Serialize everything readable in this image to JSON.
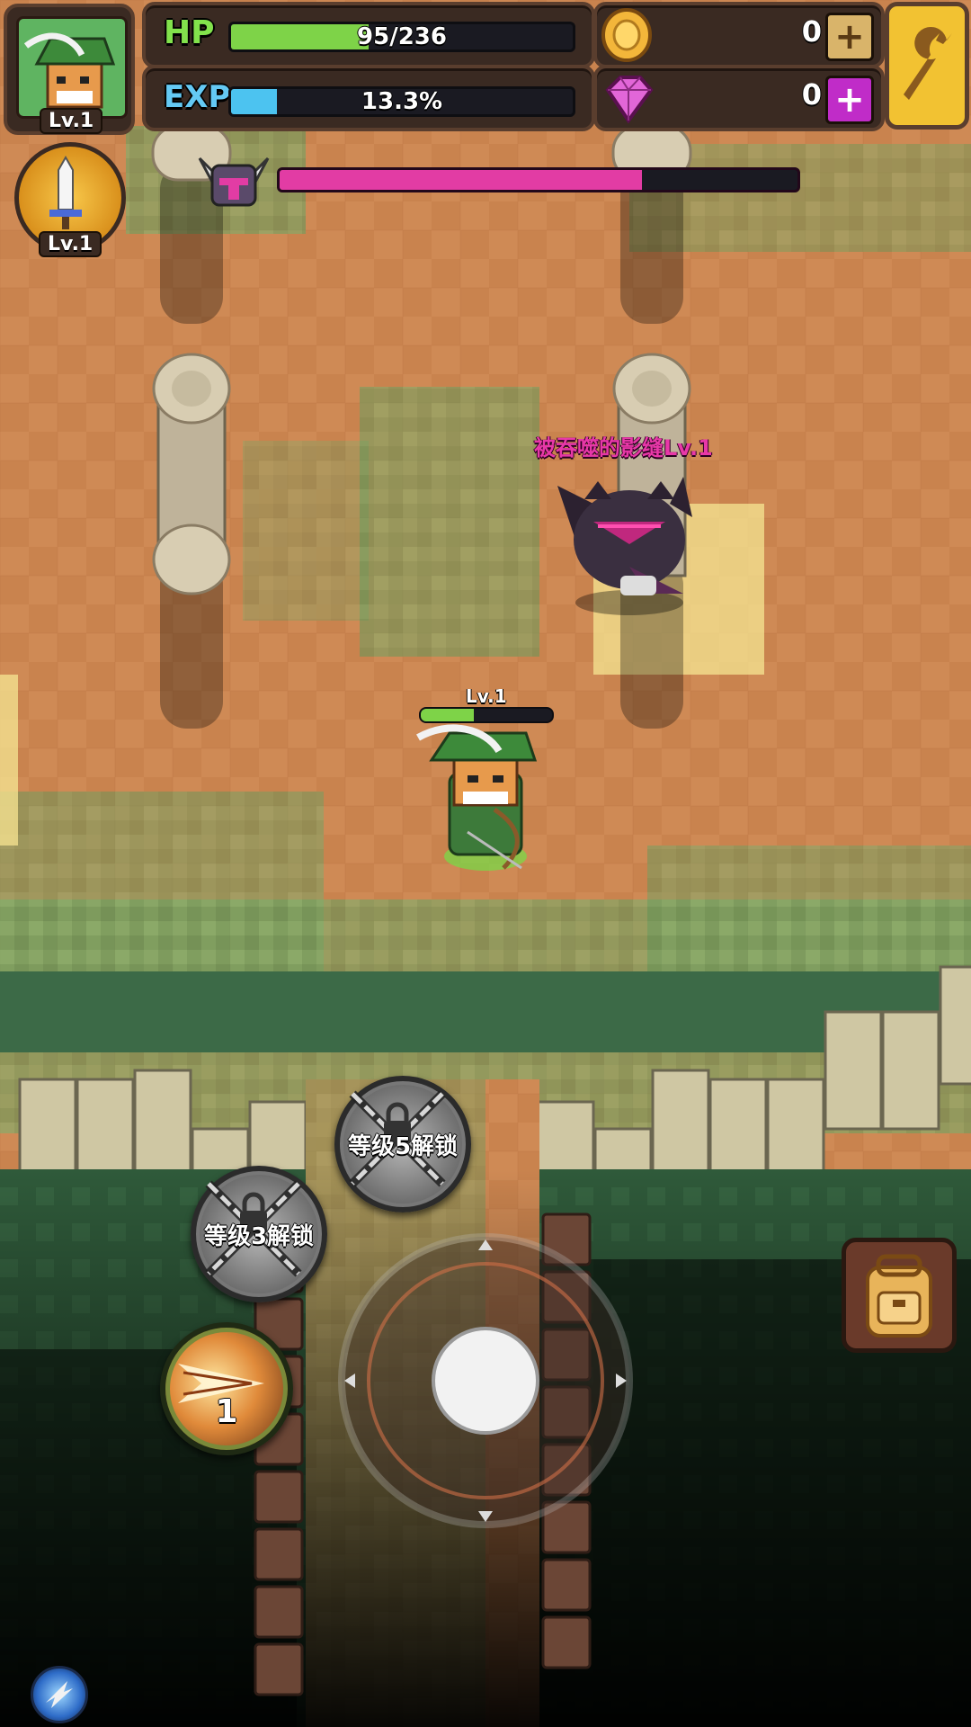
{
  "player": {
    "portrait_level": "Lv.1",
    "weapon_level": "Lv.1",
    "hp_label": "HP",
    "hp_text": "95/236",
    "hp_fraction": 0.4025,
    "exp_label": "EXP",
    "exp_text": "13.3%",
    "exp_fraction": 0.133,
    "overhead_level": "Lv.1",
    "overhead_hp_fraction": 0.4025
  },
  "currency": {
    "gold_value": "0",
    "gold_plus": "+",
    "gem_value": "0",
    "gem_plus": "+"
  },
  "boss": {
    "name": "被吞噬的影缝Lv.1",
    "hp_fraction": 0.7
  },
  "skills": {
    "lock_level3": "等级3解锁",
    "lock_level5": "等级5解锁",
    "arrow_skill_count": "1"
  },
  "icons": {
    "settings": "wrench-icon",
    "inventory": "backpack-icon",
    "gold": "gold-coin-icon",
    "gem": "pink-gem-icon",
    "boss": "horned-helmet-icon",
    "weapon": "sword-icon",
    "joystick": "virtual-joystick",
    "auto": "auto-attack-orb-icon"
  },
  "colors": {
    "hp_fill": "#7ed348",
    "exp_fill": "#4cc3f0",
    "boss_fill": "#e23ca4",
    "gem_accent": "#c02cc8",
    "gold_accent": "#f3b63a",
    "settings_bg": "#f2c232"
  }
}
